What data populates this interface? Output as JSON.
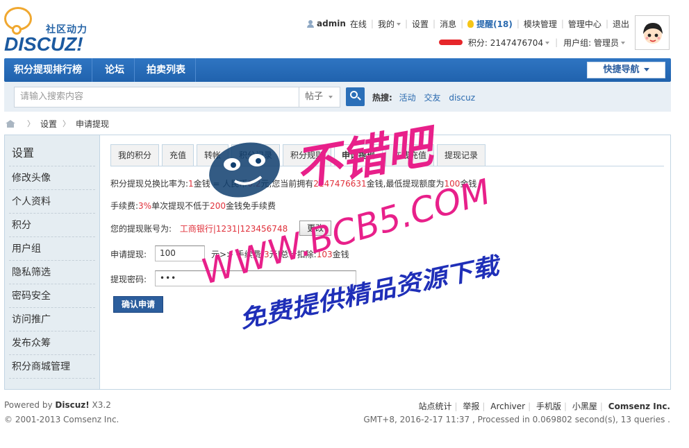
{
  "header": {
    "logo_cn": "社区动力",
    "logo_en": "DISCUZ!",
    "user": {
      "username": "admin",
      "status": "在线",
      "mine": "我的",
      "settings": "设置",
      "messages": "消息",
      "remind": "提醒(18)",
      "module_manage": "模块管理",
      "admin_center": "管理中心",
      "logout": "退出"
    },
    "credits": "积分: 2147476704",
    "usergroup": "用户组: 管理员"
  },
  "nav": {
    "items": [
      "积分提现排行榜",
      "论坛",
      "拍卖列表"
    ],
    "quick_nav": "快捷导航"
  },
  "search": {
    "placeholder": "请输入搜索内容",
    "type": "帖子",
    "hot_label": "热搜:",
    "hot_links": [
      "活动",
      "交友",
      "discuz"
    ]
  },
  "breadcrumb": {
    "items": [
      "设置",
      "申请提现"
    ]
  },
  "sidebar": {
    "title": "设置",
    "items": [
      "修改头像",
      "个人资料",
      "积分",
      "用户组",
      "隐私筛选",
      "密码安全",
      "访问推广",
      "发布众筹",
      "积分商城管理"
    ]
  },
  "tabs": [
    "我的积分",
    "充值",
    "转帐",
    "积分记录",
    "积分规则",
    "申请提现",
    "在线充值",
    "提现记录"
  ],
  "active_tab": "申请提现",
  "form": {
    "rate_line": {
      "a": "积分提现兑换比率为:",
      "b": "1",
      "c": "金钱 = 人民币",
      "d": "0.2",
      "e": "元,您当前拥有",
      "f": "2147476631",
      "g": "金钱,最低提现额度为",
      "h": "100",
      "i": "金钱"
    },
    "fee_line": {
      "a": "手续费:",
      "b": "3%",
      "c": "单次提现不低于",
      "d": "200",
      "e": "金钱免手续费"
    },
    "account_label": "您的提现账号为:",
    "account_value": "工商银行|1231|123456748",
    "change_button": "更改",
    "amount_label": "申请提现:",
    "amount_value": "100",
    "amount_hint": {
      "a": "元>> 手续费:",
      "b": "3",
      "c": "元|总计扣除:",
      "d": "103",
      "e": "金钱"
    },
    "password_label": "提现密码:",
    "password_value": "•••",
    "submit": "确认申请"
  },
  "watermark": {
    "line1": "不错吧",
    "line2": "WWW.BCB5.COM",
    "line3": "免费提供精品资源下载",
    "color": "#e8208a"
  },
  "footer": {
    "powered_a": "Powered by ",
    "powered_b": "Discuz!",
    "powered_c": " X3.2",
    "copyright": "© 2001-2013 Comsenz Inc.",
    "links": [
      "站点统计",
      "举报",
      "Archiver",
      "手机版",
      "小黑屋"
    ],
    "company": "Comsenz Inc.",
    "stats": "GMT+8, 2016-2-17 11:37 , Processed in 0.069802 second(s), 13 queries ."
  }
}
